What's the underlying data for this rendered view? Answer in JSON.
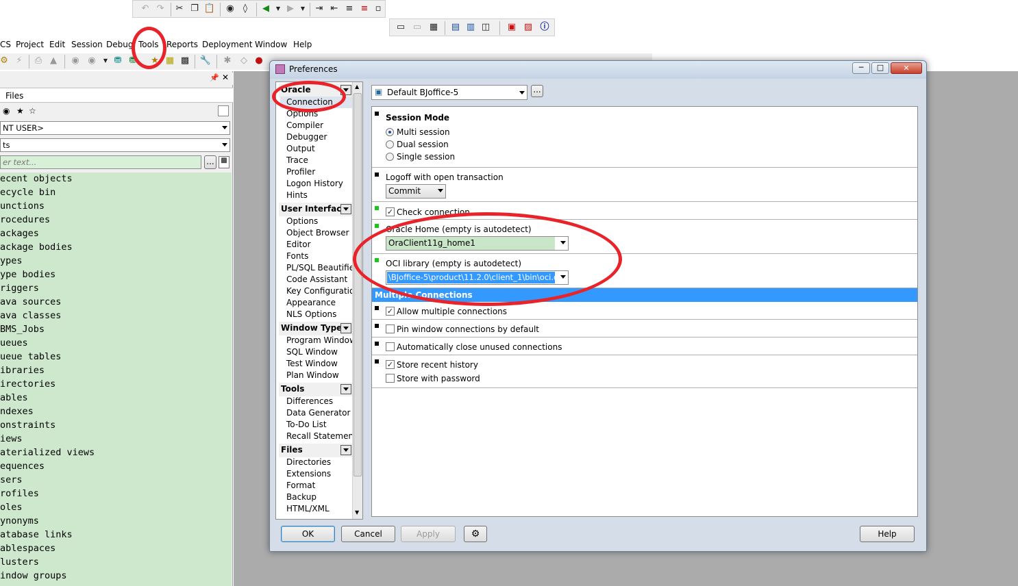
{
  "menubar": {
    "items": [
      "CS",
      "Project",
      "Edit",
      "Session",
      "Debug",
      "Tools",
      "Reports",
      "Deployment",
      "Window",
      "Help"
    ]
  },
  "left_panel": {
    "tab_files": "Files",
    "user_combo": "NT USER>",
    "type_combo": "ts",
    "filter_placeholder": "er text...",
    "filter_button": "...",
    "tree_items": [
      "ecent objects",
      "ecycle bin",
      "unctions",
      "rocedures",
      "ackages",
      "ackage bodies",
      "ypes",
      "ype bodies",
      "riggers",
      "ava sources",
      "ava classes",
      "BMS_Jobs",
      "ueues",
      "ueue tables",
      "ibraries",
      "irectories",
      "ables",
      "ndexes",
      "onstraints",
      "iews",
      "aterialized views",
      "equences",
      "sers",
      "rofiles",
      "oles",
      "ynonyms",
      "atabase links",
      "ablespaces",
      "lusters",
      "indow groups"
    ]
  },
  "dialog": {
    "title": "Preferences",
    "connection_combo": "Default BJoffice-5",
    "browse_button": "...",
    "nav": {
      "oracle_header": "Oracle",
      "oracle_items": [
        "Connection",
        "Options",
        "Compiler",
        "Debugger",
        "Output",
        "Trace",
        "Profiler",
        "Logon History",
        "Hints"
      ],
      "ui_header": "User Interface",
      "ui_items": [
        "Options",
        "Object Browser",
        "Editor",
        "Fonts",
        "PL/SQL Beautifier",
        "Code Assistant",
        "Key Configuration",
        "Appearance",
        "NLS Options"
      ],
      "wt_header": "Window Types",
      "wt_items": [
        "Program Window",
        "SQL Window",
        "Test Window",
        "Plan Window"
      ],
      "tools_header": "Tools",
      "tools_items": [
        "Differences",
        "Data Generator",
        "To-Do List",
        "Recall Statement"
      ],
      "files_header": "Files",
      "files_items": [
        "Directories",
        "Extensions",
        "Format",
        "Backup",
        "HTML/XML"
      ]
    },
    "session_mode": {
      "title": "Session Mode",
      "options": [
        "Multi session",
        "Dual session",
        "Single session"
      ]
    },
    "logoff": {
      "label": "Logoff with open transaction",
      "value": "Commit"
    },
    "check_connection": "Check connection",
    "oracle_home": {
      "label": "Oracle Home (empty is autodetect)",
      "value": "OraClient11g_home1"
    },
    "oci_library": {
      "label": "OCI library (empty is autodetect)",
      "value": "\\BJoffice-5\\product\\11.2.0\\client_1\\bin\\oci.dll"
    },
    "multiple_connections": {
      "header": "Multiple Connections",
      "allow": "Allow multiple connections",
      "pin": "Pin window connections by default",
      "auto_close": "Automatically close unused connections",
      "store_history": "Store recent history",
      "store_password": "Store with password"
    },
    "buttons": {
      "ok": "OK",
      "cancel": "Cancel",
      "apply": "Apply",
      "help": "Help"
    }
  },
  "colors": {
    "annotation_ring": "#e8232a",
    "tree_background": "#cde8cd",
    "selected_section": "#3399ff"
  }
}
